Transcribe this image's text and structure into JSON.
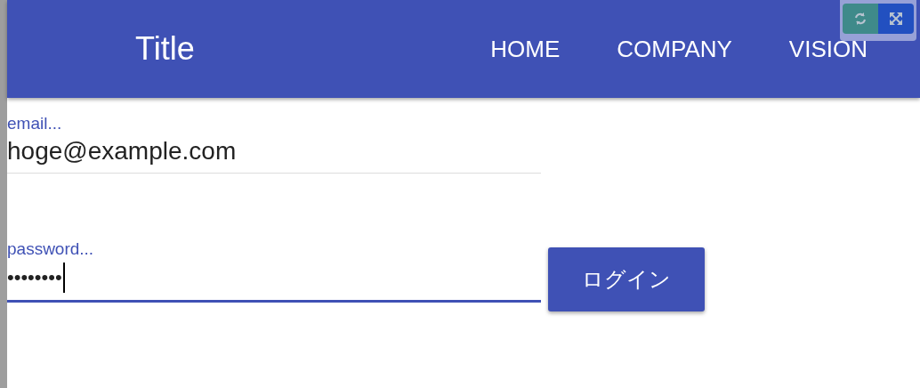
{
  "app_bar": {
    "title": "Title",
    "nav": [
      "HOME",
      "COMPANY",
      "VISION"
    ]
  },
  "form": {
    "fields": [
      {
        "label": "email...",
        "value": "hoge@example.com",
        "focused": false
      },
      {
        "label": "password...",
        "value": "••••••••",
        "focused": true
      }
    ],
    "button": "ログイン"
  }
}
